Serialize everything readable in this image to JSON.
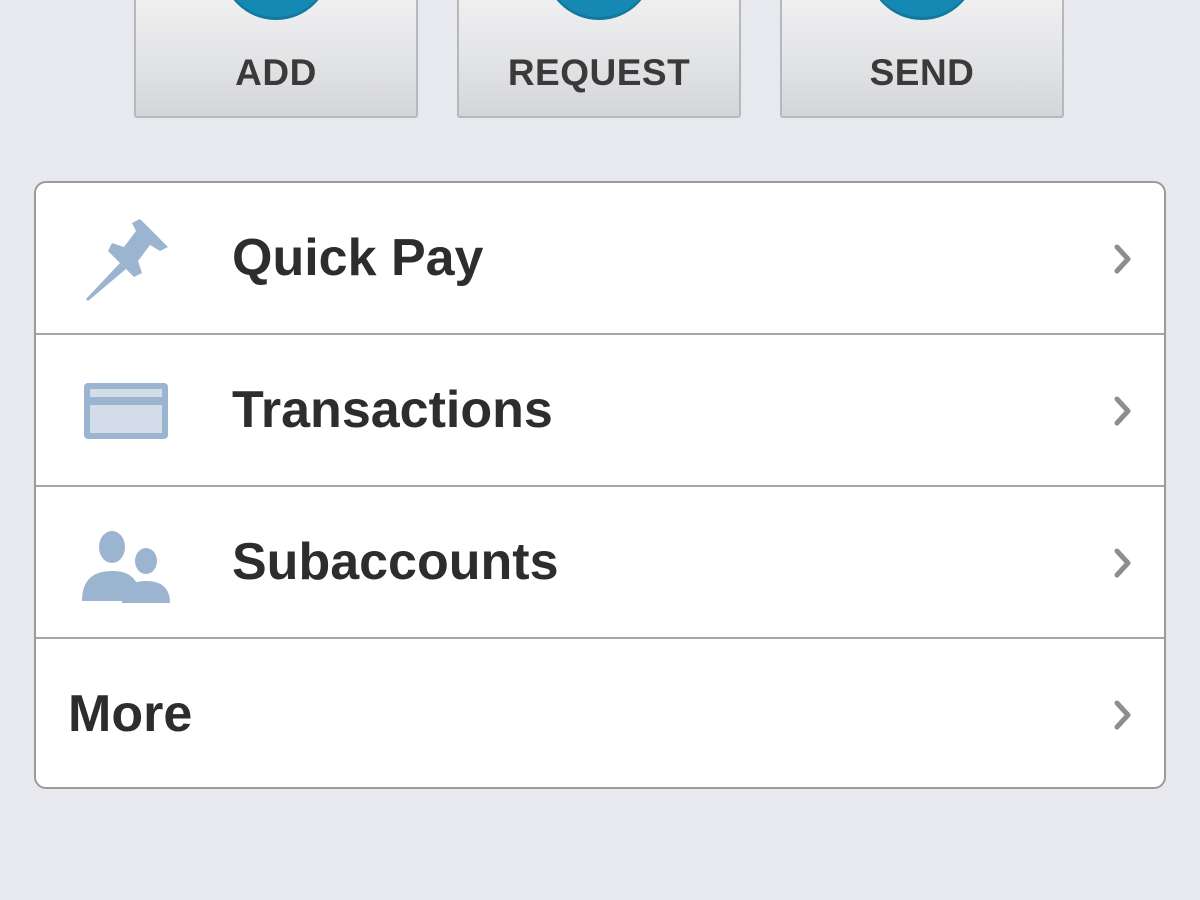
{
  "actions": {
    "add_label": "ADD",
    "request_label": "REQUEST",
    "send_label": "SEND"
  },
  "menu": {
    "items": [
      {
        "label": "Quick Pay",
        "icon": "pushpin-icon"
      },
      {
        "label": "Transactions",
        "icon": "credit-card-icon"
      },
      {
        "label": "Subaccounts",
        "icon": "users-icon"
      },
      {
        "label": "More",
        "icon": ""
      }
    ]
  },
  "colors": {
    "accent": "#1589b3",
    "icon": "#9bb4cf",
    "background": "#e7e9ef",
    "text": "#2d2d2d"
  }
}
